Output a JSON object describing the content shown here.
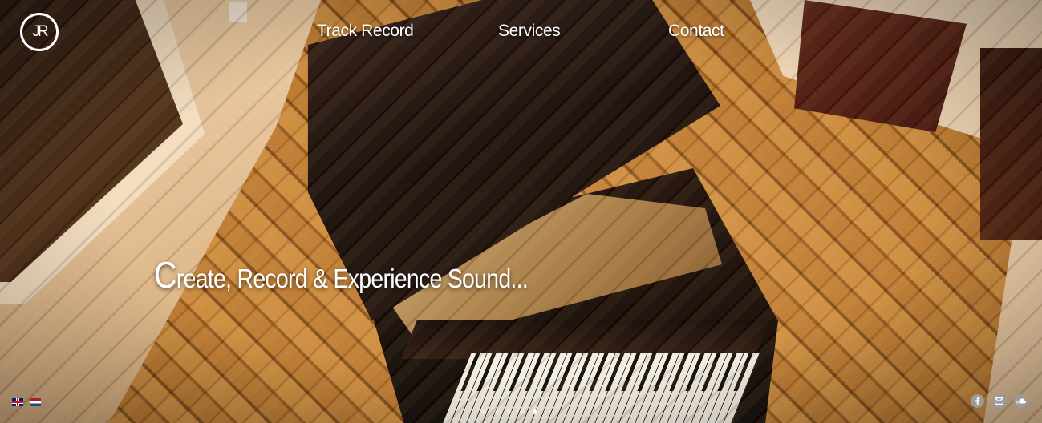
{
  "logo": {
    "text": "JR"
  },
  "nav": {
    "items": [
      {
        "label": "Track Record"
      },
      {
        "label": "Services"
      },
      {
        "label": "Contact"
      }
    ]
  },
  "hero": {
    "tagline_initial": "C",
    "tagline_rest": "reate, Record & Experience Sound..."
  },
  "languages": [
    "en-flag-icon",
    "nl-flag-icon"
  ],
  "slider": {
    "count": 5,
    "active_index": 4
  },
  "social": [
    "facebook-icon",
    "email-icon",
    "soundcloud-icon"
  ],
  "colors": {
    "text": "#ffffff",
    "social_icon_bg": "#9a9a9a"
  }
}
